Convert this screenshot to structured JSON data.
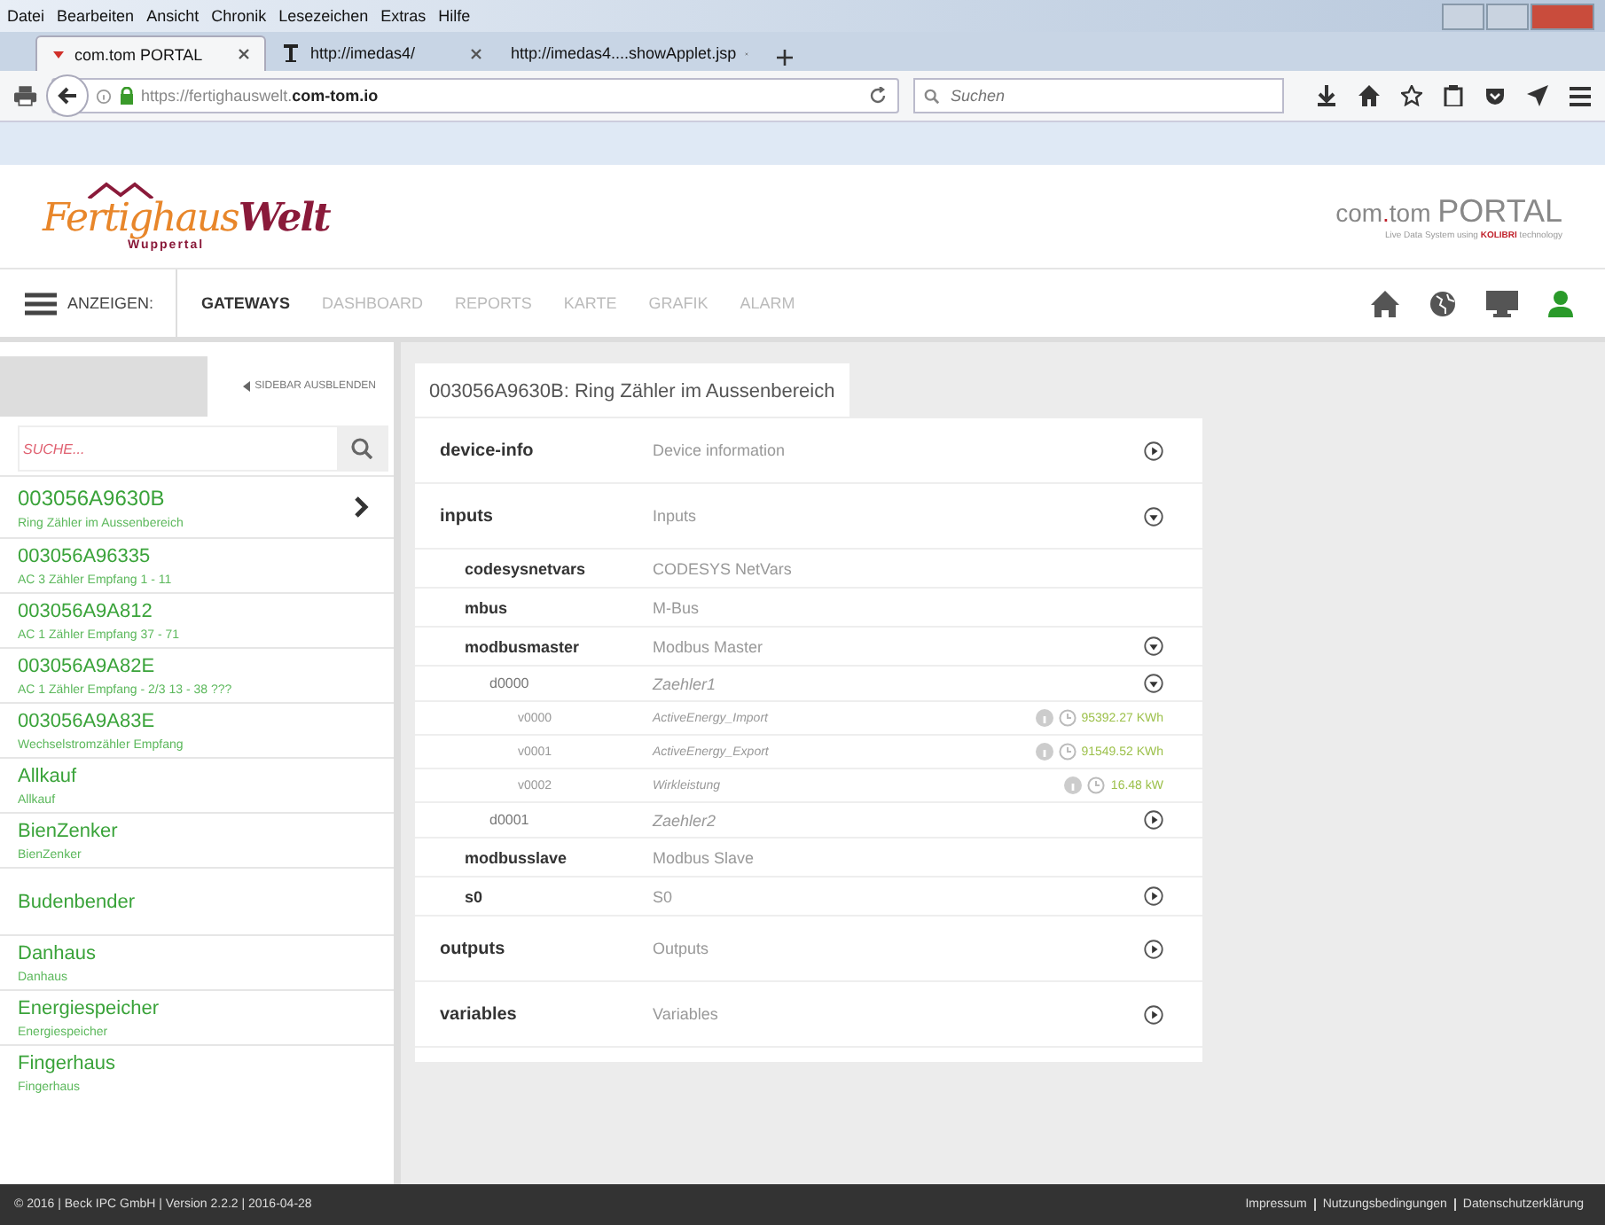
{
  "browser": {
    "menu": [
      "Datei",
      "Bearbeiten",
      "Ansicht",
      "Chronik",
      "Lesezeichen",
      "Extras",
      "Hilfe"
    ],
    "tabs": [
      {
        "label": "com.tom PORTAL",
        "kind": "portal",
        "selected": true
      },
      {
        "label": "http://imedas4/",
        "kind": "text",
        "selected": false
      },
      {
        "label": "http://imedas4....showApplet.jsp",
        "kind": "none",
        "selected": false
      }
    ],
    "url_prefix": "https://fertighauswelt.",
    "url_domain": "com-tom.io",
    "search": {
      "placeholder": "Suchen"
    }
  },
  "header": {
    "logo_main": "Fertighaus",
    "logo_accent": "Welt",
    "logo_sub": "Wuppertal",
    "portal_a": "com",
    "portal_dot": ".",
    "portal_b": "tom",
    "portal_c": "PORTAL",
    "portal_tag_a": "Live Data System using",
    "portal_tag_brand": "KOLIBRI",
    "portal_tag_b": "technology"
  },
  "nav": {
    "menu_label": "ANZEIGEN:",
    "items": [
      {
        "label": "GATEWAYS",
        "selected": true
      },
      {
        "label": "DASHBOARD",
        "selected": false
      },
      {
        "label": "REPORTS",
        "selected": false
      },
      {
        "label": "KARTE",
        "selected": false
      },
      {
        "label": "GRAFIK",
        "selected": false
      },
      {
        "label": "ALARM",
        "selected": false
      }
    ]
  },
  "sidebar": {
    "hide_button": "SIDEBAR AUSBLENDEN",
    "search": {
      "placeholder": "SUCHE..."
    },
    "items": [
      {
        "title": "003056A9630B",
        "subtitle": "Ring Zähler im Aussenbereich",
        "selected": true
      },
      {
        "title": "003056A96335",
        "subtitle": "AC 3 Zähler Empfang 1 - 11",
        "selected": false
      },
      {
        "title": "003056A9A812",
        "subtitle": "AC 1 Zähler Empfang 37 - 71",
        "selected": false
      },
      {
        "title": "003056A9A82E",
        "subtitle": "AC 1 Zähler Empfang - 2/3 13 - 38 ???",
        "selected": false
      },
      {
        "title": "003056A9A83E",
        "subtitle": "Wechselstromzähler Empfang",
        "selected": false
      },
      {
        "title": "Allkauf",
        "subtitle": "Allkauf",
        "selected": false
      },
      {
        "title": "BienZenker",
        "subtitle": "BienZenker",
        "selected": false
      },
      {
        "title": "Budenbender",
        "selected": false
      },
      {
        "title": "Danhaus",
        "subtitle": "Danhaus",
        "selected": false
      },
      {
        "title": "Energiespeicher",
        "subtitle": "Energiespeicher",
        "selected": false
      },
      {
        "title": "Fingerhaus",
        "subtitle": "Fingerhaus",
        "selected": false
      }
    ]
  },
  "main": {
    "title": "003056A9630B: Ring Zähler im Aussenbereich",
    "rows": [
      {
        "name": "device-info",
        "description": "Device information",
        "expanded": false
      },
      {
        "name": "inputs",
        "description": "Inputs",
        "expanded": true,
        "children": [
          {
            "name": "codesysnetvars",
            "description": "CODESYS NetVars"
          },
          {
            "name": "mbus",
            "description": "M-Bus"
          },
          {
            "name": "modbusmaster",
            "description": "Modbus Master",
            "expanded": true,
            "children": [
              {
                "name": "d0000",
                "description": "Zaehler1",
                "expanded": true,
                "children": [
                  {
                    "name": "v0000",
                    "description": "ActiveEnergy_Import",
                    "value": "95392.27 KWh"
                  },
                  {
                    "name": "v0001",
                    "description": "ActiveEnergy_Export",
                    "value": "91549.52 KWh"
                  },
                  {
                    "name": "v0002",
                    "description": "Wirkleistung",
                    "value": "16.48 kW"
                  }
                ]
              },
              {
                "name": "d0001",
                "description": "Zaehler2",
                "expanded": false
              }
            ]
          },
          {
            "name": "modbusslave",
            "description": "Modbus Slave"
          },
          {
            "name": "s0",
            "description": "S0",
            "expanded": false
          }
        ]
      },
      {
        "name": "outputs",
        "description": "Outputs",
        "expanded": false
      },
      {
        "name": "variables",
        "description": "Variables",
        "expanded": false
      }
    ]
  },
  "footer": {
    "copyright": "© 2016 | Beck IPC GmbH | Version 2.2.2 | 2016-04-28",
    "links": [
      "Impressum",
      "Nutzungsbedingungen",
      "Datenschutzerklärung"
    ]
  }
}
